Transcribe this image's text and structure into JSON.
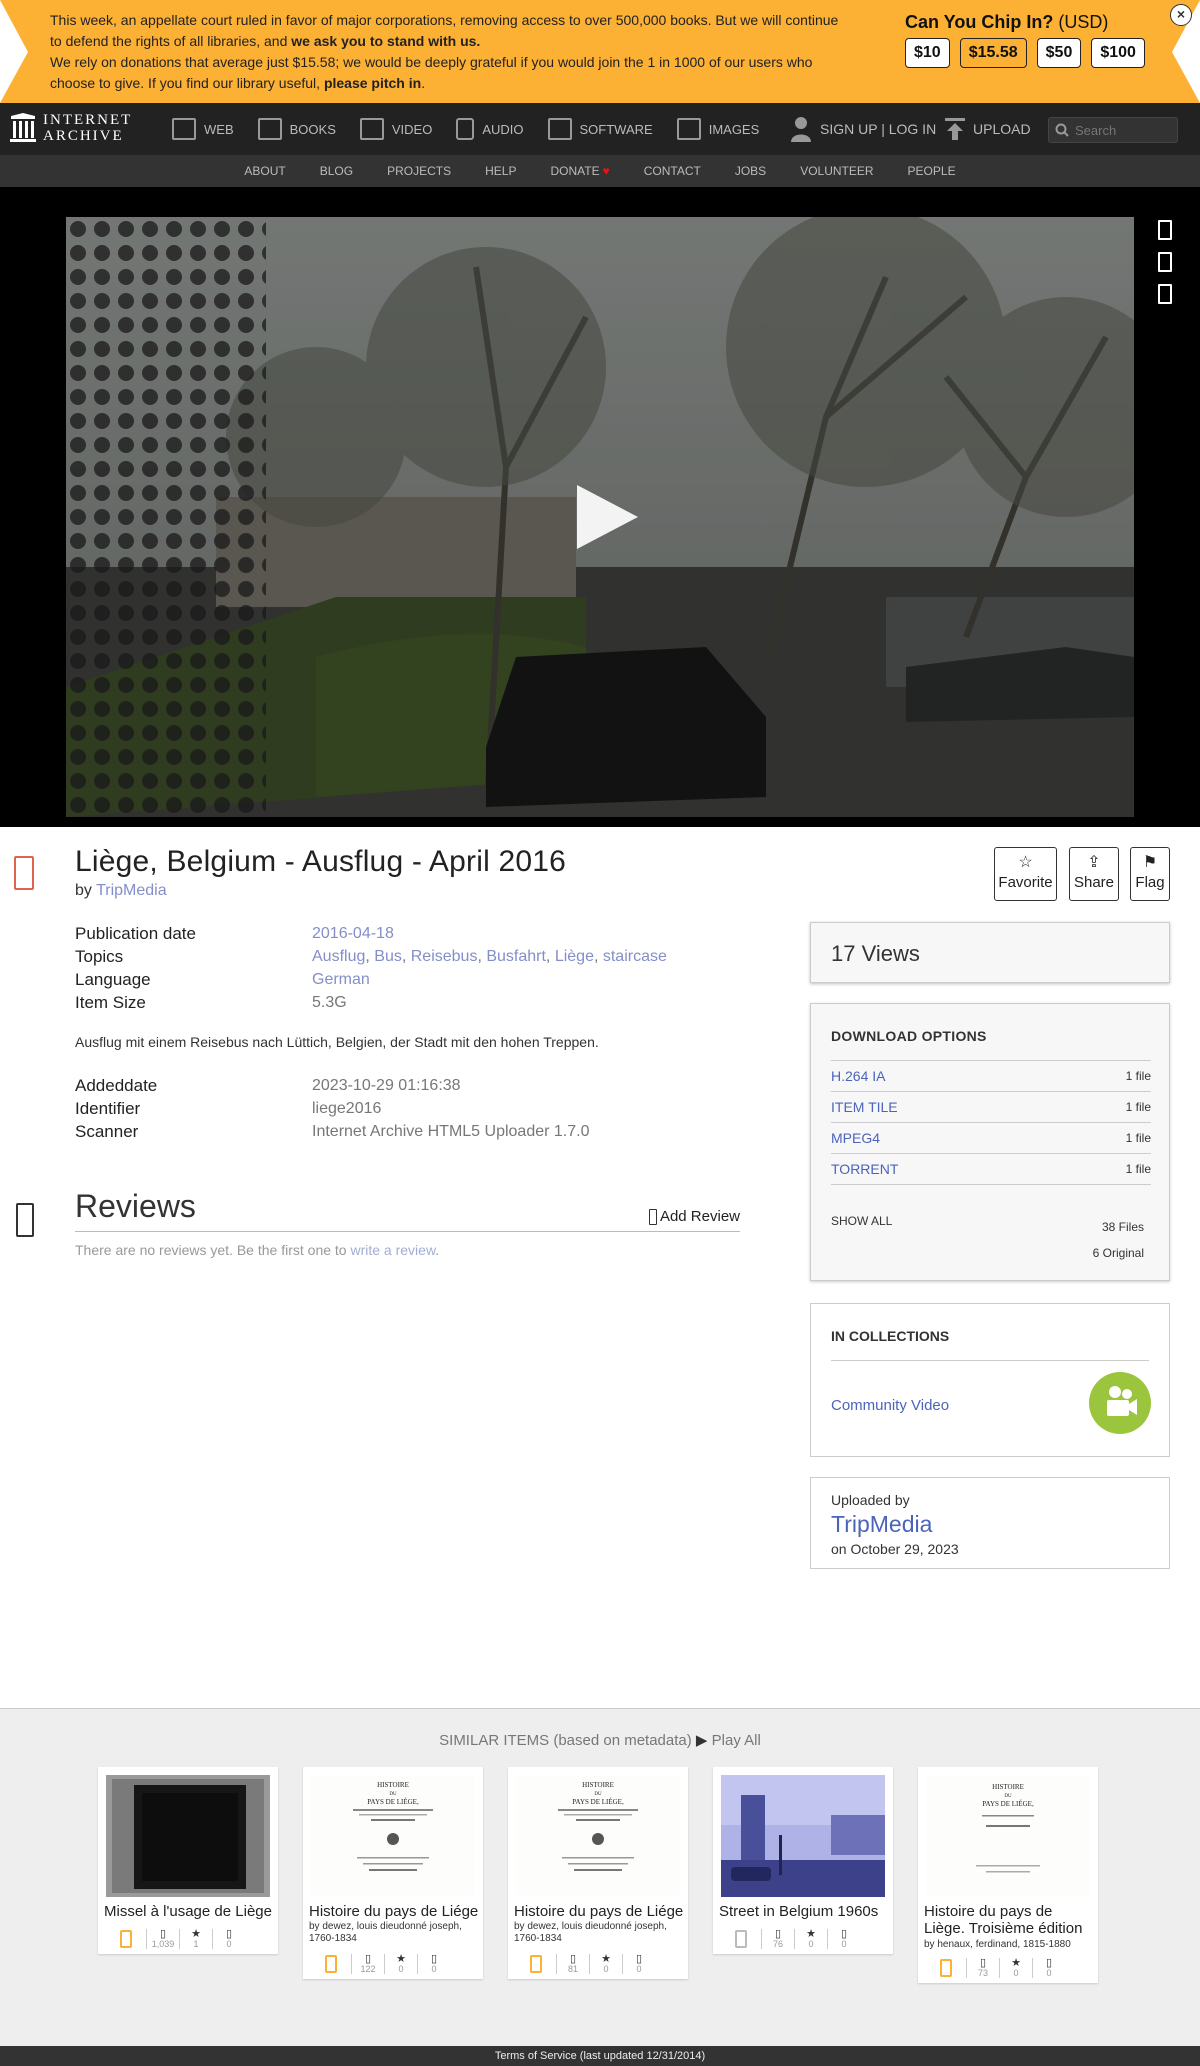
{
  "banner": {
    "message_p1": "This week, an appellate court ruled in favor of major corporations, removing access to over 500,000 books. But we will continue to defend the rights of all libraries, and ",
    "message_p1_bold": "we ask you to stand with us.",
    "message_p2": "We rely on donations that average just $15.58; we would be deeply grateful if you would join the 1 in 1000 of our users who choose to give. If you find our library useful, ",
    "message_p2_bold": "please pitch in",
    "message_p2_end": ".",
    "chip_title": "Can You Chip In?",
    "chip_currency": "(USD)",
    "amounts": [
      "$10",
      "$15.58",
      "$50",
      "$100"
    ],
    "close_label": "×"
  },
  "topnav": {
    "logo_line1": "INTERNET",
    "logo_line2": "ARCHIVE",
    "media": [
      {
        "label": "WEB",
        "icon": "web-icon"
      },
      {
        "label": "BOOKS",
        "icon": "books-icon"
      },
      {
        "label": "VIDEO",
        "icon": "video-icon"
      },
      {
        "label": "AUDIO",
        "icon": "audio-icon"
      },
      {
        "label": "SOFTWARE",
        "icon": "software-icon"
      },
      {
        "label": "IMAGES",
        "icon": "images-icon"
      }
    ],
    "signup": "SIGN UP | LOG IN",
    "upload": "UPLOAD",
    "search_placeholder": "Search"
  },
  "subnav": [
    "ABOUT",
    "BLOG",
    "PROJECTS",
    "HELP",
    "DONATE",
    "CONTACT",
    "JOBS",
    "VOLUNTEER",
    "PEOPLE"
  ],
  "item": {
    "title": "Liège, Belgium - Ausflug - April 2016",
    "by_prefix": "by",
    "creator": "TripMedia",
    "actions": [
      {
        "glyph": "☆",
        "label": "Favorite"
      },
      {
        "glyph": "⇪",
        "label": "Share"
      },
      {
        "glyph": "⚑",
        "label": "Flag"
      }
    ],
    "metadata": {
      "pubdate_key": "Publication date",
      "pubdate": "2016-04-18",
      "topics_key": "Topics",
      "topics": [
        "Ausflug",
        "Bus",
        "Reisebus",
        "Busfahrt",
        "Liège",
        "staircase"
      ],
      "language_key": "Language",
      "language": "German",
      "size_key": "Item Size",
      "size": "5.3G"
    },
    "description": "Ausflug mit einem Reisebus nach Lüttich, Belgien, der Stadt mit den hohen Treppen.",
    "metadata2": {
      "addeddate_key": "Addeddate",
      "addeddate": "2023-10-29 01:16:38",
      "identifier_key": "Identifier",
      "identifier": "liege2016",
      "scanner_key": "Scanner",
      "scanner": "Internet Archive HTML5 Uploader 1.7.0"
    }
  },
  "reviews": {
    "heading": "Reviews",
    "add": "Add Review",
    "empty_text": "There are no reviews yet. Be the first one to ",
    "empty_link": "write a review",
    "empty_end": "."
  },
  "views": "17 Views",
  "downloads": {
    "heading": "DOWNLOAD OPTIONS",
    "items": [
      {
        "format": "H.264 IA",
        "count": "1 file"
      },
      {
        "format": "ITEM TILE",
        "count": "1 file"
      },
      {
        "format": "MPEG4",
        "count": "1 file"
      },
      {
        "format": "TORRENT",
        "count": "1 file"
      }
    ],
    "show_all": "SHOW ALL",
    "files": "38 Files",
    "original": "6 Original"
  },
  "collections": {
    "heading": "IN COLLECTIONS",
    "items": [
      "Community Video"
    ]
  },
  "uploader": {
    "label": "Uploaded by",
    "name": "TripMedia",
    "date": "on October 29, 2023"
  },
  "similar": {
    "heading": "SIMILAR ITEMS (based on metadata)",
    "play_all": "Play All",
    "cards": [
      {
        "title": "Missel à l'usage de Liège",
        "author": "",
        "views": "1,039",
        "favs": "1",
        "reviews": "0"
      },
      {
        "title": "Histoire du pays de Liége",
        "author": "by dewez, louis dieudonné joseph, 1760-1834",
        "views": "122",
        "favs": "0",
        "reviews": "0"
      },
      {
        "title": "Histoire du pays de Liége",
        "author": "by dewez, louis dieudonné joseph, 1760-1834",
        "views": "81",
        "favs": "0",
        "reviews": "0"
      },
      {
        "title": "Street in Belgium 1960s",
        "author": "",
        "views": "76",
        "favs": "0",
        "reviews": "0"
      },
      {
        "title": "Histoire du pays de Liège. Troisième édition",
        "author": "by henaux, ferdinand, 1815-1880",
        "views": "73",
        "favs": "0",
        "reviews": "0"
      }
    ],
    "thumb_texts": {
      "histoire": "HISTOIRE",
      "du": "DU",
      "pays": "PAYS DE LIÉGE,"
    }
  },
  "footer": "Terms of Service (last updated 12/31/2014)",
  "colors": {
    "banner": "#fcb034",
    "nav": "#222222",
    "subnav": "#333333",
    "link": "#4b64bb",
    "accent_icon": "#e0634d",
    "collection_badge": "#9bc53d"
  }
}
